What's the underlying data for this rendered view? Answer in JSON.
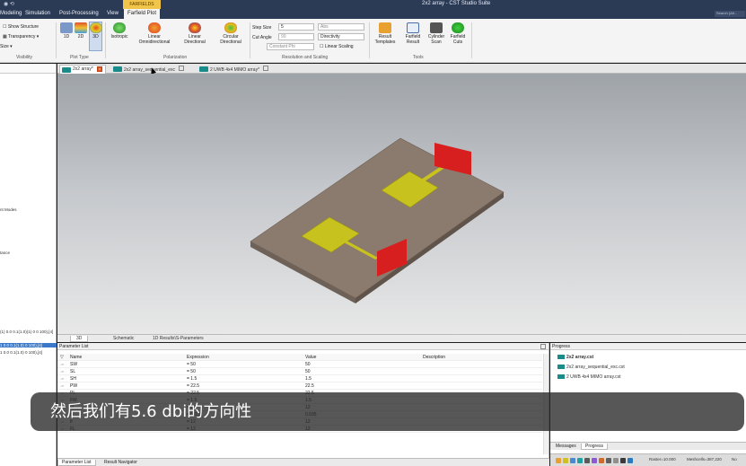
{
  "window": {
    "title": "2x2 array - CST Studio Suite",
    "context_tab": "FARFIELDS"
  },
  "menu": {
    "tabs": [
      "Modeling",
      "Simulation",
      "Post-Processing",
      "View",
      "Farfield Plot"
    ],
    "search_placeholder": "Search (Alt..."
  },
  "ribbon": {
    "visibility": {
      "show_structure": "Show Structure",
      "transparency": "Transparency",
      "size": "Size",
      "label": "Visibility"
    },
    "plot_type": {
      "buttons": [
        "1D",
        "2D",
        "3D"
      ],
      "label": "Plot Type"
    },
    "polarization": {
      "buttons": [
        "Isotropic",
        "Linear Omnidirectional",
        "Linear Directional",
        "Circular Directional"
      ],
      "label": "Polarization"
    },
    "resolution": {
      "step_size_label": "Step Size",
      "step_size_value": "5",
      "cut_angle_label": "Cut Angle",
      "cut_angle_value": "90",
      "constant_phi": "Constant Phi",
      "abs_value": "Abs",
      "directivity_value": "Directivity",
      "linear_scaling": "Linear Scaling",
      "label": "Resolution and Scaling"
    },
    "tools": {
      "buttons": [
        "Result Templates",
        "Farfield Result",
        "Cylinder Scan",
        "Farfield Cuts"
      ],
      "label": "Tools"
    }
  },
  "doc_tabs": [
    {
      "label": "2x2 array*",
      "active": true
    },
    {
      "label": "2x2 array_sequential_exc",
      "active": false
    },
    {
      "label": "2 UWB 4x4 MIMO array*",
      "active": false
    }
  ],
  "left_tree": {
    "items": [
      "nt Modes",
      "tance",
      "(1) 0.0 0.1(1.0)(1) 0 0 100),[4]",
      "1 0.0 0.1(1.0) 0 100),[4]",
      "1 0.0 0.1(1.0) 0 100),[4]"
    ]
  },
  "viewport_tabs": [
    "3D",
    "Schematic",
    "1D Results\\S-Parameters"
  ],
  "parameter_list": {
    "title": "Parameter List",
    "columns": [
      "Name",
      "Expression",
      "Value",
      "Description"
    ],
    "rows": [
      {
        "name": "SW",
        "expression": "= 50",
        "value": "50",
        "description": ""
      },
      {
        "name": "SL",
        "expression": "= 50",
        "value": "50",
        "description": ""
      },
      {
        "name": "SH",
        "expression": "= 1.5",
        "value": "1.5",
        "description": ""
      },
      {
        "name": "PW",
        "expression": "= 22.5",
        "value": "22.5",
        "description": ""
      },
      {
        "name": "PL",
        "expression": "= 22.5",
        "value": "22.5",
        "description": ""
      },
      {
        "name": "FW",
        "expression": "= 1.5",
        "value": "1.5",
        "description": ""
      },
      {
        "name": "FL",
        "expression": "= 12",
        "value": "12",
        "description": ""
      },
      {
        "name": "h",
        "expression": "= 0.035",
        "value": "0.035",
        "description": ""
      },
      {
        "name": "fr",
        "expression": "= 12",
        "value": "12",
        "description": ""
      },
      {
        "name": "FL",
        "expression": "= 12",
        "value": "12",
        "description": ""
      }
    ],
    "bottom_tabs": [
      "Parameter List",
      "Result Navigator"
    ]
  },
  "progress": {
    "title": "Progress",
    "items": [
      "2x2 array.cst",
      "2x2 array_sequential_exc.cst",
      "2 UWB 4x4 MIMO array.cst"
    ],
    "bottom_tabs": [
      "Messages",
      "Progress"
    ]
  },
  "status": {
    "raster": "Raster=10.000",
    "meshcells": "Meshcells=387,220",
    "extra": "No"
  },
  "subtitle": "然后我们有5.6 dbi的方向性",
  "colors": {
    "title_bar": "#2b3a55",
    "substrate": "#8b7b6e",
    "patch": "#c8c21e",
    "port": "#d81f1f"
  }
}
